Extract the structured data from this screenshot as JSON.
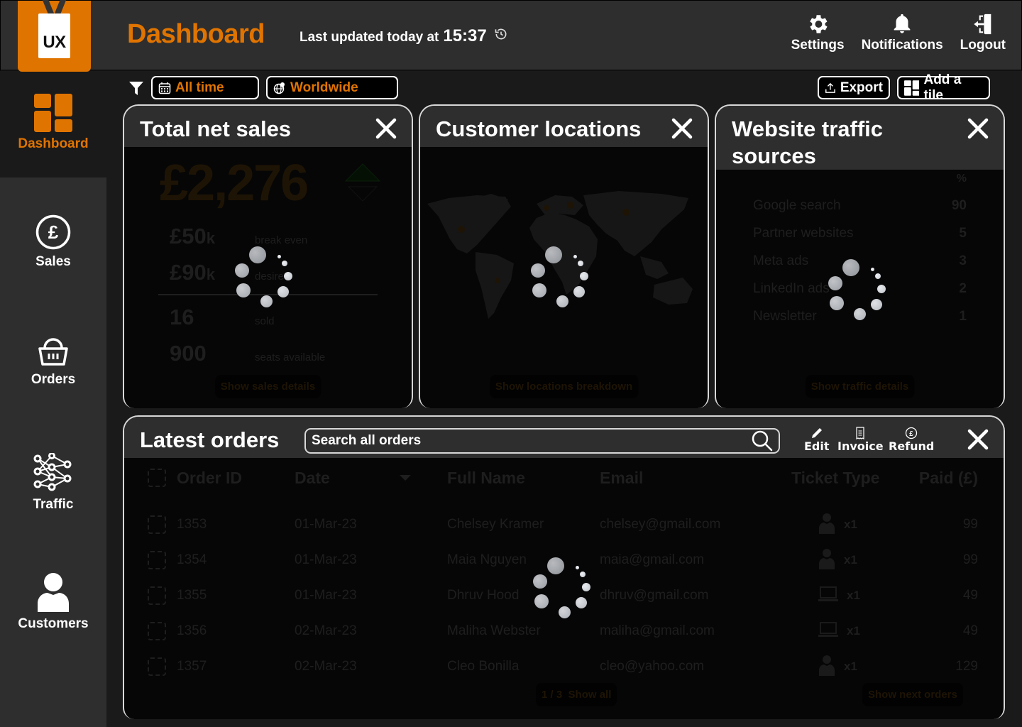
{
  "header": {
    "logo_text": "UX",
    "title": "Dashboard",
    "last_updated_prefix": "Last updated today at",
    "last_updated_time": "15:37",
    "actions": [
      {
        "label": "Settings",
        "icon": "gear-icon"
      },
      {
        "label": "Notifications",
        "icon": "bell-icon"
      },
      {
        "label": "Logout",
        "icon": "logout-icon"
      }
    ]
  },
  "sidebar": {
    "items": [
      {
        "label": "Dashboard",
        "icon": "dashboard-grid-icon",
        "active": true
      },
      {
        "label": "Sales",
        "icon": "pound-circle-icon"
      },
      {
        "label": "Orders",
        "icon": "basket-icon"
      },
      {
        "label": "Traffic",
        "icon": "network-icon"
      },
      {
        "label": "Customers",
        "icon": "person-icon"
      }
    ]
  },
  "filters": {
    "time": "All time",
    "region": "Worldwide",
    "export_label": "Export",
    "add_tile_label": "Add a tile"
  },
  "tiles": {
    "sales": {
      "title": "Total net sales",
      "total": "£2,276",
      "stats": [
        {
          "value": "£50",
          "suffix": "k",
          "label": "break even"
        },
        {
          "value": "£90",
          "suffix": "k",
          "label": "desired"
        },
        {
          "value": "16",
          "suffix": "",
          "label": "sold"
        },
        {
          "value": "900",
          "suffix": "",
          "label": "seats available"
        }
      ],
      "button": "Show sales details",
      "loading": true
    },
    "locations": {
      "title": "Customer locations",
      "button": "Show locations breakdown",
      "loading": true
    },
    "traffic": {
      "title": "Website traffic sources",
      "unit": "%",
      "rows": [
        {
          "source": "Google search",
          "value": "90"
        },
        {
          "source": "Partner websites",
          "value": "5"
        },
        {
          "source": "Meta ads",
          "value": "3"
        },
        {
          "source": "LinkedIn ads",
          "value": "2"
        },
        {
          "source": "Newsletter",
          "value": "1"
        }
      ],
      "button": "Show traffic details",
      "loading": true
    }
  },
  "orders": {
    "title": "Latest orders",
    "search_placeholder": "Search all orders",
    "actions": {
      "edit": "Edit",
      "invoice": "Invoice",
      "refund": "Refund"
    },
    "columns": [
      "Order ID",
      "Date",
      "Full Name",
      "Email",
      "Ticket Type",
      "Paid (£)"
    ],
    "rows": [
      {
        "id": "1353",
        "date": "01-Mar-23",
        "name": "Chelsey Kramer",
        "email": "chelsey@gmail.com",
        "ticket": "in-person",
        "qty": "x1",
        "paid": "99"
      },
      {
        "id": "1354",
        "date": "01-Mar-23",
        "name": "Maia Nguyen",
        "email": "maia@gmail.com",
        "ticket": "in-person",
        "qty": "x1",
        "paid": "99"
      },
      {
        "id": "1355",
        "date": "01-Mar-23",
        "name": "Dhruv Hood",
        "email": "dhruv@gmail.com",
        "ticket": "online",
        "qty": "x1",
        "paid": "49"
      },
      {
        "id": "1356",
        "date": "02-Mar-23",
        "name": "Maliha Webster",
        "email": "maliha@gmail.com",
        "ticket": "online",
        "qty": "x1",
        "paid": "49"
      },
      {
        "id": "1357",
        "date": "02-Mar-23",
        "name": "Cleo Bonilla",
        "email": "cleo@yahoo.com",
        "ticket": "in-person",
        "qty": "x1",
        "paid": "129"
      }
    ],
    "pagination": "1 / 3",
    "show_all": "Show all",
    "show_next": "Show next orders",
    "loading": true
  },
  "colors": {
    "accent": "#e07400",
    "panel": "#2e2e2e",
    "background": "#1a1a1a"
  }
}
